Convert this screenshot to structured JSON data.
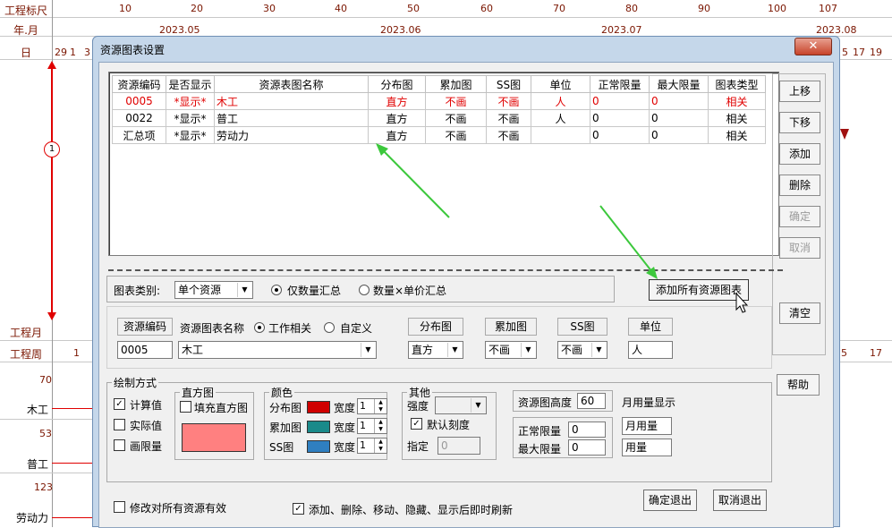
{
  "background": {
    "left_labels": {
      "ruler": "工程标尺",
      "year_month": "年.月",
      "day": "日",
      "project_month": "工程月",
      "project_week": "工程周",
      "node_number": "1"
    },
    "ruler_ticks": [
      "10",
      "20",
      "30",
      "40",
      "50",
      "60",
      "70",
      "80",
      "90",
      "100",
      "107"
    ],
    "months": [
      "2023.05",
      "2023.06",
      "2023.07",
      "2023.08"
    ],
    "days_left": [
      "29",
      "1",
      "3"
    ],
    "days_right": [
      "5",
      "17",
      "19"
    ],
    "week_left": "1",
    "week_right": [
      "5",
      "17"
    ],
    "resources": [
      {
        "name": "木工",
        "value": "70"
      },
      {
        "name": "普工",
        "value": "53"
      },
      {
        "name": "劳动力",
        "value": "123"
      }
    ]
  },
  "dialog": {
    "title": "资源图表设置",
    "close": "✕",
    "table": {
      "headers": [
        "资源编码",
        "是否显示",
        "资源表图名称",
        "分布图",
        "累加图",
        "SS图",
        "单位",
        "正常限量",
        "最大限量",
        "图表类型"
      ],
      "rows": [
        [
          "0005",
          "*显示*",
          "木工",
          "直方",
          "不画",
          "不画",
          "人",
          "0",
          "0",
          "相关"
        ],
        [
          "0022",
          "*显示*",
          "普工",
          "直方",
          "不画",
          "不画",
          "人",
          "0",
          "0",
          "相关"
        ],
        [
          "汇总项",
          "*显示*",
          "劳动力",
          "直方",
          "不画",
          "不画",
          "",
          "0",
          "0",
          "相关"
        ]
      ]
    },
    "right_buttons": {
      "up": "上移",
      "down": "下移",
      "add": "添加",
      "delete": "删除",
      "confirm": "确定",
      "cancel": "取消",
      "clear": "清空",
      "help": "帮助"
    },
    "chart_category_label": "图表类别:",
    "chart_category_value": "单个资源",
    "radio_qty": "仅数量汇总",
    "radio_qty_price": "数量×单价汇总",
    "add_all_button": "添加所有资源图表",
    "edit": {
      "code_header": "资源编码",
      "code_value": "0005",
      "name_header": "资源图表名称",
      "radio_work": "工作相关",
      "radio_custom": "自定义",
      "name_value": "木工",
      "dist_header": "分布图",
      "dist_value": "直方",
      "cum_header": "累加图",
      "cum_value": "不画",
      "ss_header": "SS图",
      "ss_value": "不画",
      "unit_header": "单位",
      "unit_value": "人"
    },
    "draw": {
      "group": "绘制方式",
      "calc": "计算值",
      "actual": "实际值",
      "limit": "画限量",
      "hist_group": "直方图",
      "fill_hist": "填充直方图",
      "color_group": "颜色",
      "dist_label": "分布图",
      "cum_label": "累加图",
      "ss_label": "SS图",
      "width_label": "宽度",
      "width_value": "1",
      "dist_color": "#d00000",
      "cum_color": "#1a8a8a",
      "ss_color": "#2f7fc0",
      "hist_color": "#ff8080",
      "other_group": "其他",
      "strength": "强度",
      "default_scale": "默认刻度",
      "specify": "指定",
      "specify_value": "0",
      "height_label": "资源图高度",
      "height_value": "60",
      "normal_limit": "正常限量",
      "normal_value": "0",
      "max_limit": "最大限量",
      "max_value": "0",
      "monthly_label": "月用量显示",
      "monthly_value": "月用量",
      "usage_value": "用量"
    },
    "bottom": {
      "apply_all": "修改对所有资源有效",
      "auto_refresh": "添加、删除、移动、隐藏、显示后即时刷新",
      "ok_exit": "确定退出",
      "cancel_exit": "取消退出"
    }
  }
}
